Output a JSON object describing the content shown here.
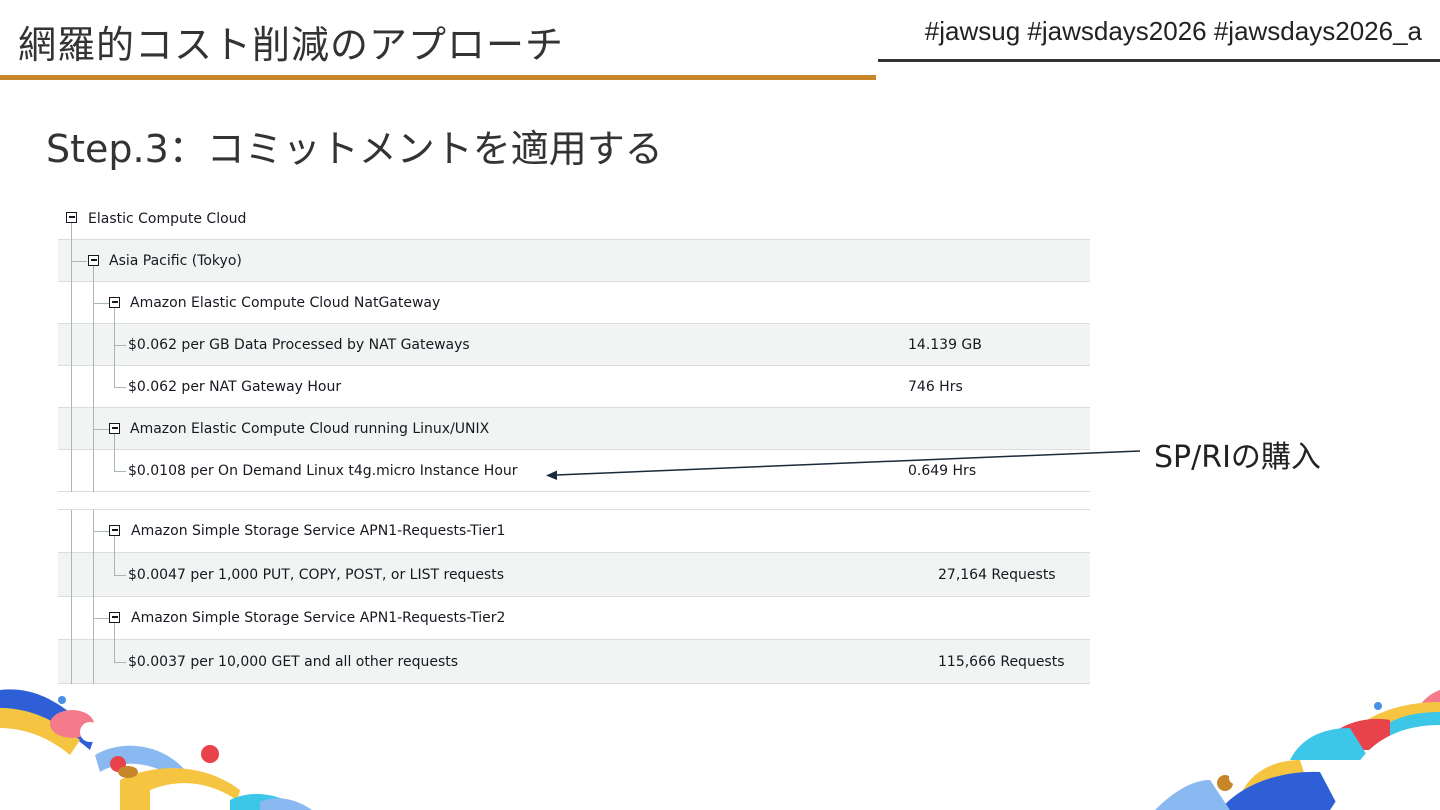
{
  "slide": {
    "title": "網羅的コスト削減のアプローチ",
    "hashtags": "#jawsug #jawsdays2026 #jawsdays2026_a",
    "subtitle": "Step.3：コミットメントを適用する",
    "annotation": "SP/RIの購入"
  },
  "billing": {
    "root": "Elastic Compute Cloud",
    "region": "Asia Pacific (Tokyo)",
    "nat_group": "Amazon Elastic Compute Cloud NatGateway",
    "nat_item1": "$0.062 per GB Data Processed by NAT Gateways",
    "nat_qty1": "14.139 GB",
    "nat_item2": "$0.062 per NAT Gateway Hour",
    "nat_qty2": "746 Hrs",
    "linux_group": "Amazon Elastic Compute Cloud running Linux/UNIX",
    "linux_item1": "$0.0108 per On Demand Linux t4g.micro Instance Hour",
    "linux_qty1": "0.649 Hrs",
    "s3_tier1_group": "Amazon Simple Storage Service APN1-Requests-Tier1",
    "s3_tier1_item": "$0.0047 per 1,000 PUT, COPY, POST, or LIST requests",
    "s3_tier1_qty": "27,164 Requests",
    "s3_tier2_group": "Amazon Simple Storage Service APN1-Requests-Tier2",
    "s3_tier2_item": "$0.0037 per 10,000 GET and all other requests",
    "s3_tier2_qty": "115,666 Requests"
  },
  "colors": {
    "title_rule": "#c8862a",
    "row_alt": "#f2f3f3",
    "deco_blue": "#4a8fe7",
    "deco_pink": "#f47a8c",
    "deco_yellow": "#f5c542",
    "deco_cyan": "#3cc6e8"
  }
}
